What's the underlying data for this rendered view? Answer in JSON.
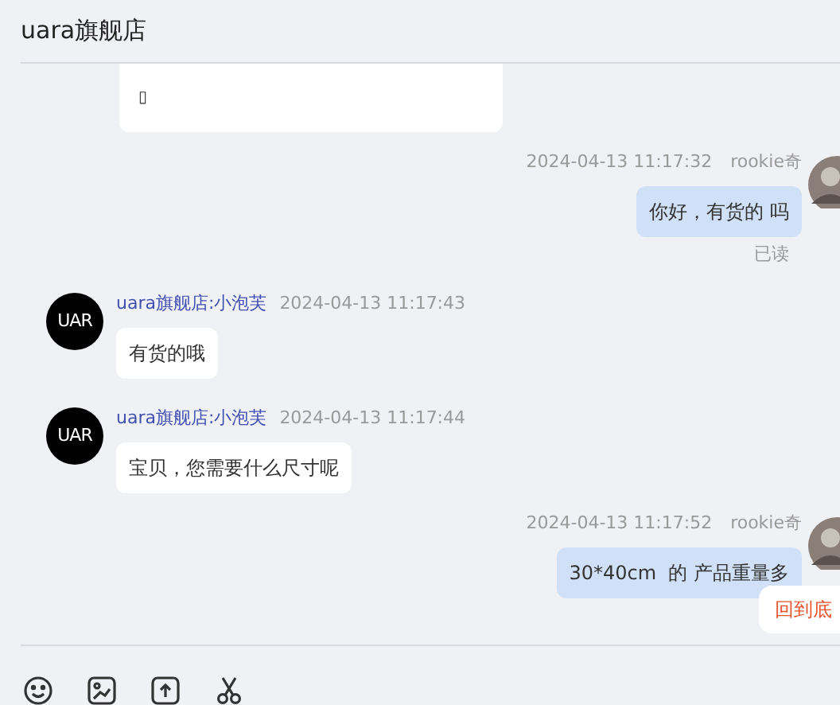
{
  "header": {
    "title": "uara旗舰店"
  },
  "messages": [
    {
      "kind": "card",
      "glyph": "▯"
    },
    {
      "kind": "outgoing",
      "time": "2024-04-13 11:17:32",
      "sender": "rookie奇",
      "text": "你好，有货的 吗",
      "read": "已读"
    },
    {
      "kind": "incoming",
      "sender": "uara旗舰店:小泡芙",
      "time": "2024-04-13 11:17:43",
      "text": "有货的哦",
      "logo": "UAR"
    },
    {
      "kind": "incoming",
      "sender": "uara旗舰店:小泡芙",
      "time": "2024-04-13 11:17:44",
      "text": "宝贝，您需要什么尺寸呢",
      "logo": "UAR"
    },
    {
      "kind": "outgoing",
      "time": "2024-04-13 11:17:52",
      "sender": "rookie奇",
      "text": "30*40cm  的 产品重量多"
    }
  ],
  "back_to_bottom": "回到底",
  "toolbar": [
    {
      "kind": "emoji"
    },
    {
      "kind": "image"
    },
    {
      "kind": "upload"
    },
    {
      "kind": "scissors"
    }
  ]
}
